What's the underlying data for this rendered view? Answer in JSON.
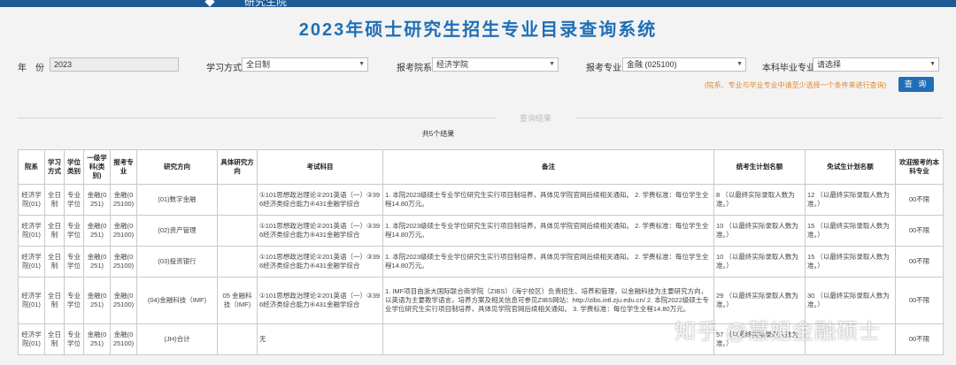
{
  "header": {
    "top_label": "研究生院",
    "title": "2023年硕士研究生招生专业目录查询系统"
  },
  "filters": {
    "year_label": "年　份",
    "year_value": "2023",
    "study_mode_label": "学习方式",
    "study_mode_value": "全日制",
    "department_label": "报考院系",
    "department_value": "经济学院",
    "major_label": "报考专业",
    "major_value": "金融 (025100)",
    "undergrad_major_label": "本科毕业专业",
    "undergrad_major_value": "请选择",
    "hint": "(院系、专业与毕业专业中请至少选择一个条件来进行查询)",
    "query_button": "查 询"
  },
  "results": {
    "label": "查询结果",
    "count": "共5个结果",
    "columns": [
      "院系",
      "学习方式",
      "学位类别",
      "一级学科(类别)",
      "报考专业",
      "研究方向",
      "具体研究方向",
      "考试科目",
      "备注",
      "统考生计划名额",
      "免试生计划名额",
      "欢迎报考的本科专业"
    ],
    "rows": [
      [
        "经济学院(01)",
        "全日制",
        "专业学位",
        "金融(0251)",
        "金融(025100)",
        "(01)数字金融",
        "",
        "①101思想政治理论②201英语（一）③396经济类综合能力④431金融学综合",
        "1. 本院2023级硕士专业学位研究生实行项目制培养，具体见学院官网后续相关通知。 2. 学费标准：每位学生全程14.80万元。",
        "8 （以最终实际录取人数为准。）",
        "12 （以最终实际录取人数为准。）",
        "00不限"
      ],
      [
        "经济学院(01)",
        "全日制",
        "专业学位",
        "金融(0251)",
        "金融(025100)",
        "(02)资产管理",
        "",
        "①101思想政治理论②201英语（一）③396经济类综合能力④431金融学综合",
        "1. 本院2023级硕士专业学位研究生实行项目制培养，具体见学院官网后续相关通知。 2. 学费标准：每位学生全程14.80万元。",
        "10 （以最终实际录取人数为准。）",
        "15 （以最终实际录取人数为准。）",
        "00不限"
      ],
      [
        "经济学院(01)",
        "全日制",
        "专业学位",
        "金融(0251)",
        "金融(025100)",
        "(03)投资银行",
        "",
        "①101思想政治理论②201英语（一）③396经济类综合能力④431金融学综合",
        "1. 本院2023级硕士专业学位研究生实行项目制培养，具体见学院官网后续相关通知。 2. 学费标准：每位学生全程14.80万元。",
        "10 （以最终实际录取人数为准。）",
        "15 （以最终实际录取人数为准。）",
        "00不限"
      ],
      [
        "经济学院(01)",
        "全日制",
        "专业学位",
        "金融(0251)",
        "金融(025100)",
        "(04)金融科技（IMF)",
        "05 金融科技（IMF)",
        "①101思想政治理论②201英语（一）③396经济类综合能力④431金融学综合",
        "1. IMF项目由浙大国际联合商学院（ZIBS）（海宁校区）负责招生、培养和管理，以金融科技为主要研究方向，以英语为主要教学语言，培养方案及相关信息可参见ZIBS网站：http://zibs.intl.zju.edu.cn/ 2. 本院2022级硕士专业学位研究生实行项目制培养，具体见学院官网后续相关通知。 3. 学费标准：每位学生全程14.80万元。",
        "29 （以最终实际录取人数为准。）",
        "30 （以最终实际录取人数为准。）",
        "00不限"
      ],
      [
        "经济学院(01)",
        "全日制",
        "专业学位",
        "金融(0251)",
        "金融(025100)",
        "(JH)合计",
        "",
        "无",
        "",
        "57 （以最终实际录取人数为准。）",
        "",
        "00不限"
      ]
    ]
  },
  "watermark": "知乎 @慧姐金融硕士"
}
